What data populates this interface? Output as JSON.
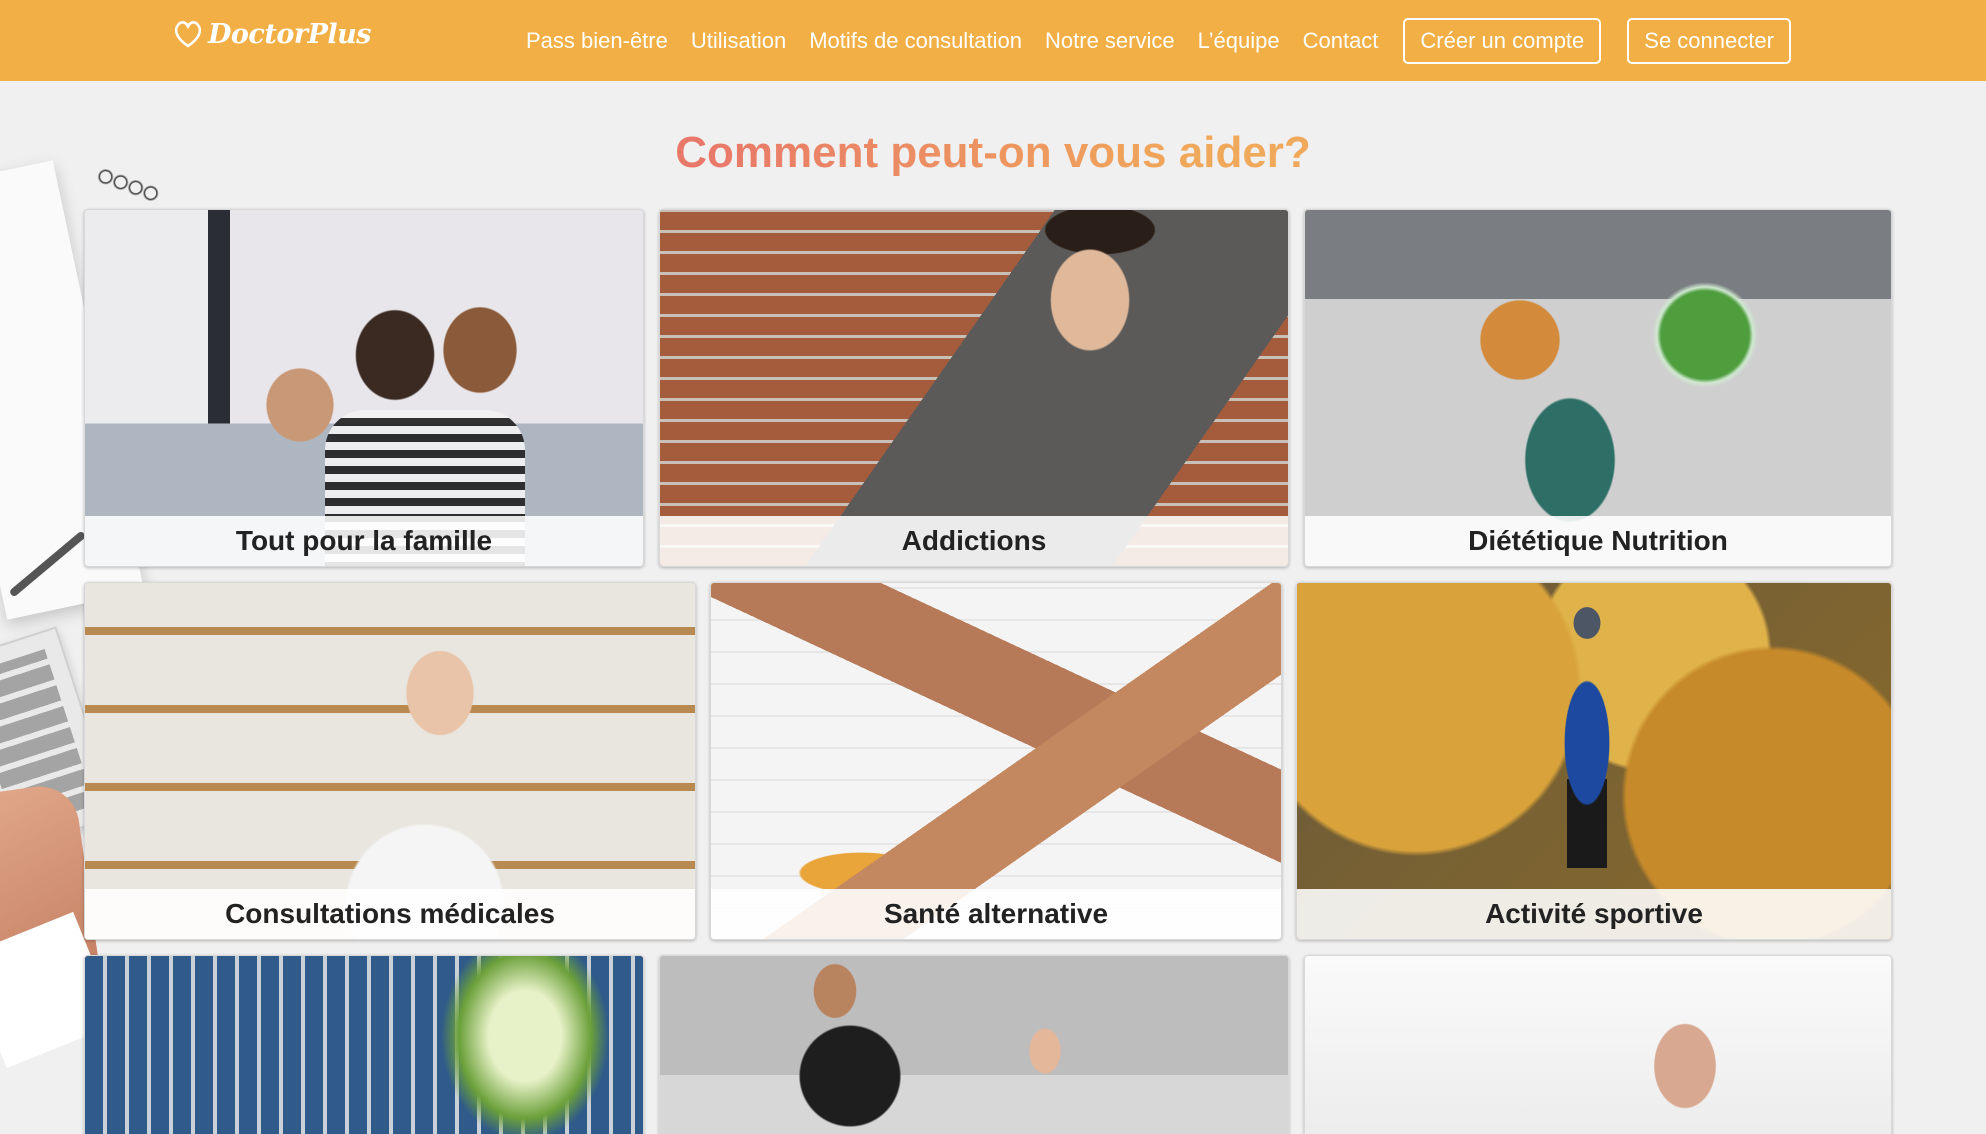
{
  "brand": {
    "name": "DoctorPlus"
  },
  "nav": {
    "links": [
      "Pass bien-être",
      "Utilisation",
      "Motifs de consultation",
      "Notre service",
      "L’équipe",
      "Contact"
    ],
    "signup": "Créer un compte",
    "login": "Se connecter"
  },
  "headline": "Comment peut-on vous aider?",
  "cards": [
    {
      "label": "Tout pour la famille"
    },
    {
      "label": "Addictions"
    },
    {
      "label": "Diététique Nutrition"
    },
    {
      "label": "Consultations médicales"
    },
    {
      "label": "Santé alternative"
    },
    {
      "label": "Activité sportive"
    },
    {
      "label": ""
    },
    {
      "label": ""
    },
    {
      "label": ""
    }
  ],
  "colors": {
    "header": "#f2af45",
    "title_start": "#e8786a",
    "title_end": "#f0a85a"
  }
}
